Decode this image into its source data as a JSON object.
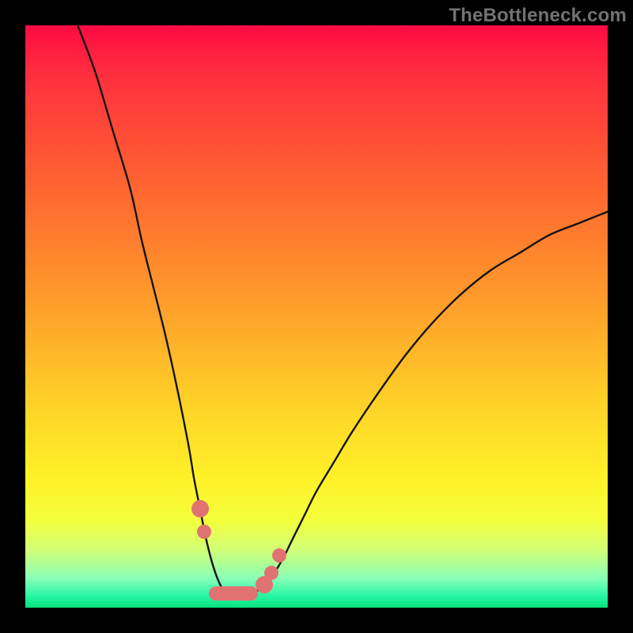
{
  "watermark": "TheBottleneck.com",
  "colors": {
    "curve": "#141414",
    "marker": "#e17272",
    "frame": "#000000"
  },
  "chart_data": {
    "type": "line",
    "title": "",
    "xlabel": "",
    "ylabel": "",
    "xlim": [
      0,
      100
    ],
    "ylim": [
      0,
      100
    ],
    "grid": false,
    "series": [
      {
        "name": "bottleneck-curve",
        "x": [
          9,
          12,
          15,
          18,
          20,
          22,
          24,
          26,
          28,
          29,
          30,
          31,
          32,
          33,
          34,
          35,
          36,
          37,
          38,
          40,
          42,
          44,
          46,
          48,
          50,
          53,
          56,
          60,
          65,
          70,
          75,
          80,
          85,
          90,
          95,
          100
        ],
        "y": [
          100,
          92,
          82,
          72,
          63,
          55,
          47,
          38,
          28,
          22,
          17,
          12,
          8,
          5,
          3,
          2,
          2,
          2,
          2,
          3,
          5,
          8,
          12,
          16,
          20,
          25,
          30,
          36,
          43,
          49,
          54,
          58,
          61,
          64,
          66,
          68
        ]
      }
    ],
    "markers": {
      "name": "highlighted-points",
      "points": [
        {
          "x": 30.0,
          "y": 17
        },
        {
          "x": 30.7,
          "y": 13
        },
        {
          "x": 41.0,
          "y": 4
        },
        {
          "x": 42.2,
          "y": 6
        },
        {
          "x": 43.6,
          "y": 9
        }
      ],
      "bar": {
        "x_start": 31.5,
        "x_end": 40.0,
        "y": 2.5
      }
    }
  }
}
